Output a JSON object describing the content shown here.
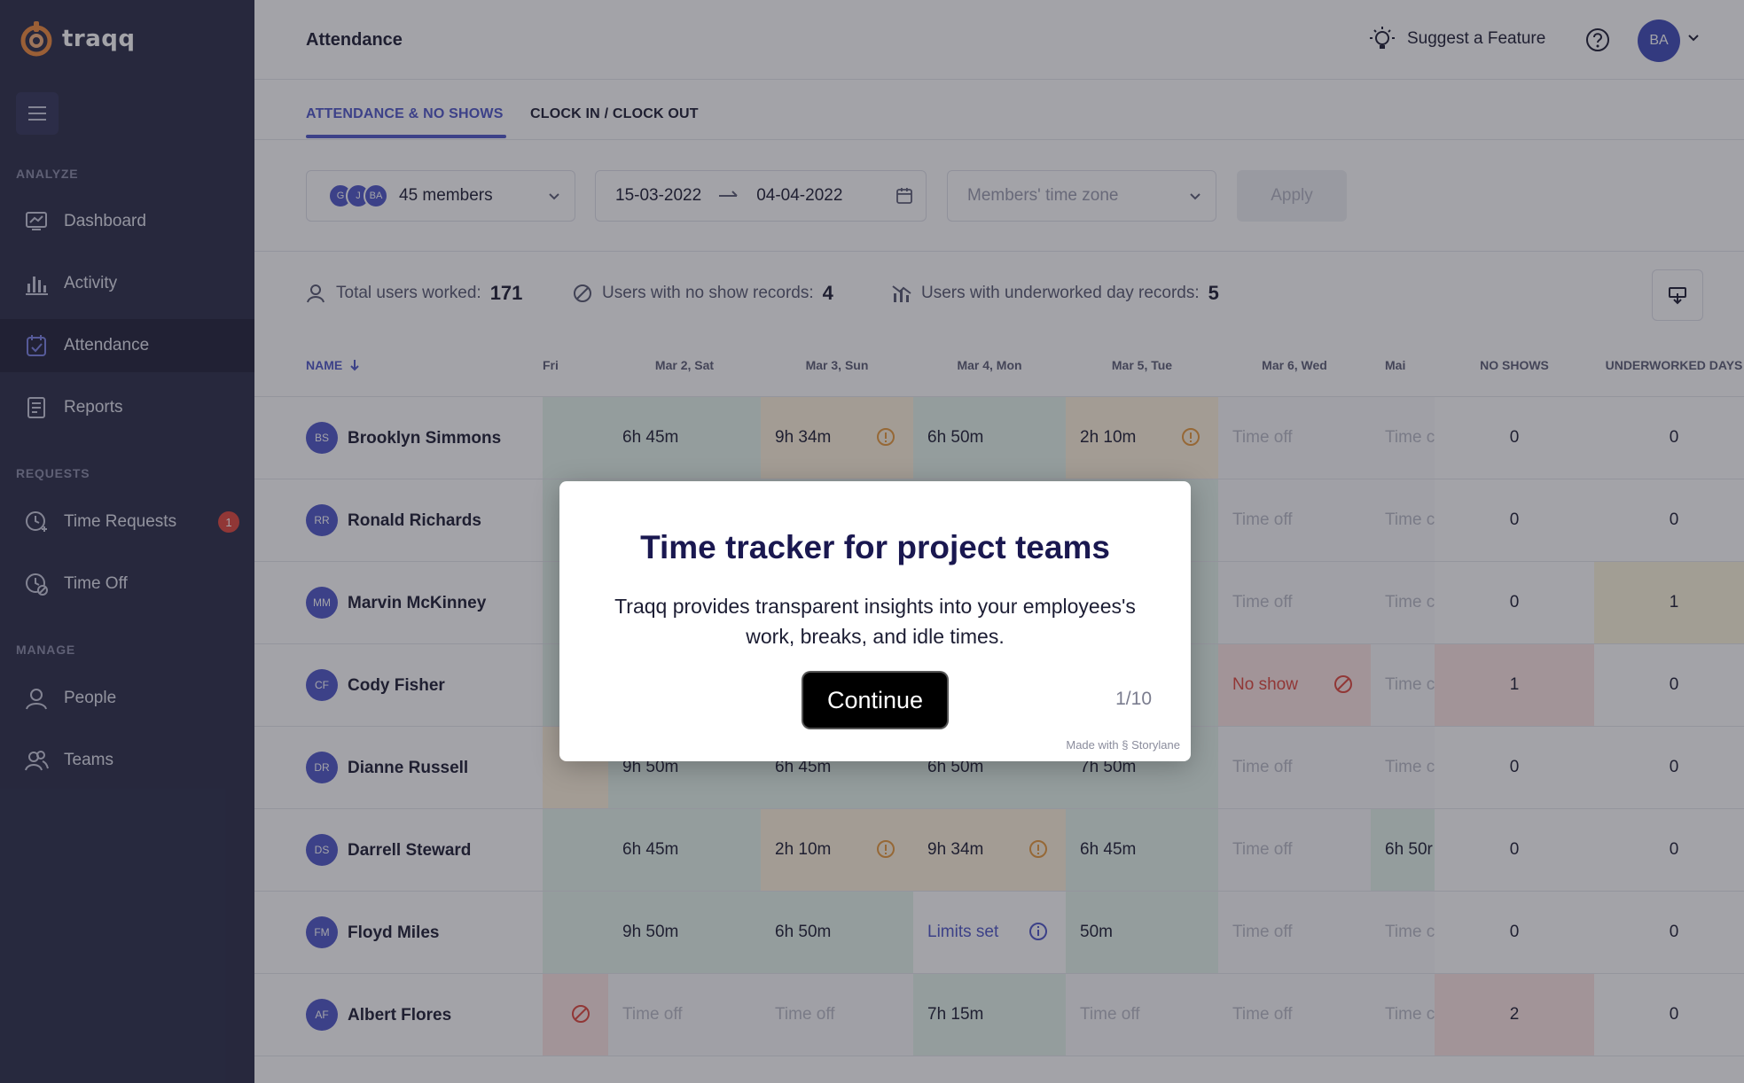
{
  "app": {
    "logo_text": "traqq"
  },
  "sidebar": {
    "sections": {
      "analyze": "ANALYZE",
      "requests": "REQUESTS",
      "manage": "MANAGE"
    },
    "items": [
      {
        "label": "Dashboard",
        "icon": "dashboard-icon"
      },
      {
        "label": "Activity",
        "icon": "bar-chart-icon"
      },
      {
        "label": "Attendance",
        "icon": "calendar-check-icon",
        "active": true
      },
      {
        "label": "Reports",
        "icon": "report-icon"
      },
      {
        "label": "Time Requests",
        "icon": "clock-plus-icon",
        "badge": "1"
      },
      {
        "label": "Time Off",
        "icon": "clock-off-icon"
      },
      {
        "label": "People",
        "icon": "person-icon"
      },
      {
        "label": "Teams",
        "icon": "team-icon"
      }
    ]
  },
  "header": {
    "title": "Attendance",
    "suggest_label": "Suggest a Feature",
    "avatar_initials": "BA"
  },
  "tabs": [
    {
      "label": "ATTENDANCE & NO SHOWS",
      "active": true
    },
    {
      "label": "CLOCK IN / CLOCK OUT",
      "active": false
    }
  ],
  "filters": {
    "member_avatars": [
      "G",
      "J",
      "BA"
    ],
    "members_label": "45 members",
    "date_from": "15-03-2022",
    "date_to": "04-04-2022",
    "timezone_placeholder": "Members' time zone",
    "apply_label": "Apply"
  },
  "stats": {
    "total_label": "Total users worked:",
    "total_value": "171",
    "noshow_label": "Users with no show records:",
    "noshow_value": "4",
    "underworked_label": "Users with underworked day records:",
    "underworked_value": "5"
  },
  "table": {
    "name_header": "NAME",
    "day_headers": [
      "Fri",
      "Mar 2, Sat",
      "Mar 3, Sun",
      "Mar 4, Mon",
      "Mar 5, Tue",
      "Mar 6, Wed",
      "Mai"
    ],
    "no_shows_header": "NO SHOWS",
    "underworked_header": "UNDERWORKED DAYS",
    "rows": [
      {
        "initials": "BS",
        "name": "Brooklyn Simmons",
        "cells": [
          [
            "ok",
            ""
          ],
          [
            "ok",
            "6h 45m"
          ],
          [
            "warn",
            "9h 34m"
          ],
          [
            "ok",
            "6h 50m"
          ],
          [
            "warn",
            "2h 10m"
          ],
          [
            "off",
            "Time off"
          ],
          [
            "off",
            "Time c"
          ]
        ],
        "no_shows": "0",
        "underworked": "0"
      },
      {
        "initials": "RR",
        "name": "Ronald Richards",
        "cells": [
          [
            "ok",
            ""
          ],
          [
            "ok",
            ""
          ],
          [
            "ok",
            ""
          ],
          [
            "ok",
            ""
          ],
          [
            "ok",
            ""
          ],
          [
            "off",
            "Time off"
          ],
          [
            "off",
            "Time c"
          ]
        ],
        "no_shows": "0",
        "underworked": "0"
      },
      {
        "initials": "MM",
        "name": "Marvin McKinney",
        "cells": [
          [
            "ok",
            ""
          ],
          [
            "ok",
            ""
          ],
          [
            "ok",
            ""
          ],
          [
            "ok",
            ""
          ],
          [
            "ok",
            ""
          ],
          [
            "off",
            "Time off"
          ],
          [
            "off",
            "Time c"
          ]
        ],
        "no_shows": "0",
        "underworked": "1"
      },
      {
        "initials": "CF",
        "name": "Cody Fisher",
        "cells": [
          [
            "ok",
            ""
          ],
          [
            "ok",
            ""
          ],
          [
            "ok",
            ""
          ],
          [
            "ok",
            ""
          ],
          [
            "ok",
            ""
          ],
          [
            "noshow",
            "No show"
          ],
          [
            "off",
            "Time c"
          ]
        ],
        "no_shows": "1",
        "underworked": "0"
      },
      {
        "initials": "DR",
        "name": "Dianne Russell",
        "cells": [
          [
            "warn",
            ""
          ],
          [
            "ok",
            "9h 50m"
          ],
          [
            "ok",
            "6h 45m"
          ],
          [
            "ok",
            "6h 50m"
          ],
          [
            "ok",
            "7h 50m"
          ],
          [
            "off",
            "Time off"
          ],
          [
            "off",
            "Time c"
          ]
        ],
        "no_shows": "0",
        "underworked": "0"
      },
      {
        "initials": "DS",
        "name": "Darrell Steward",
        "cells": [
          [
            "ok",
            ""
          ],
          [
            "ok",
            "6h 45m"
          ],
          [
            "warn",
            "2h 10m"
          ],
          [
            "warn",
            "9h 34m"
          ],
          [
            "ok",
            "6h 45m"
          ],
          [
            "off",
            "Time off"
          ],
          [
            "ok",
            "6h 50r"
          ]
        ],
        "no_shows": "0",
        "underworked": "0"
      },
      {
        "initials": "FM",
        "name": "Floyd Miles",
        "cells": [
          [
            "ok",
            ""
          ],
          [
            "ok",
            "9h 50m"
          ],
          [
            "ok",
            "6h 50m"
          ],
          [
            "limit",
            "Limits set"
          ],
          [
            "ok",
            "50m"
          ],
          [
            "off",
            "Time off"
          ],
          [
            "off",
            "Time c"
          ]
        ],
        "no_shows": "0",
        "underworked": "0"
      },
      {
        "initials": "AF",
        "name": "Albert Flores",
        "cells": [
          [
            "noshow",
            ""
          ],
          [
            "off",
            "Time off"
          ],
          [
            "off",
            "Time off"
          ],
          [
            "ok",
            "7h 15m"
          ],
          [
            "off",
            "Time off"
          ],
          [
            "off",
            "Time off"
          ],
          [
            "off",
            "Time c"
          ]
        ],
        "no_shows": "2",
        "underworked": "0"
      }
    ]
  },
  "modal": {
    "title": "Time tracker for project teams",
    "body": "Traqq provides transparent insights into your employees's work, breaks, and idle times.",
    "continue_label": "Continue",
    "step": "1/10",
    "made_with": "Made with § Storylane"
  },
  "colors": {
    "sidebar": "#2a2c48",
    "accent": "#4f56c8",
    "danger": "#e0453c",
    "ok": "#e5f5ec",
    "warn": "#fff3dd"
  }
}
